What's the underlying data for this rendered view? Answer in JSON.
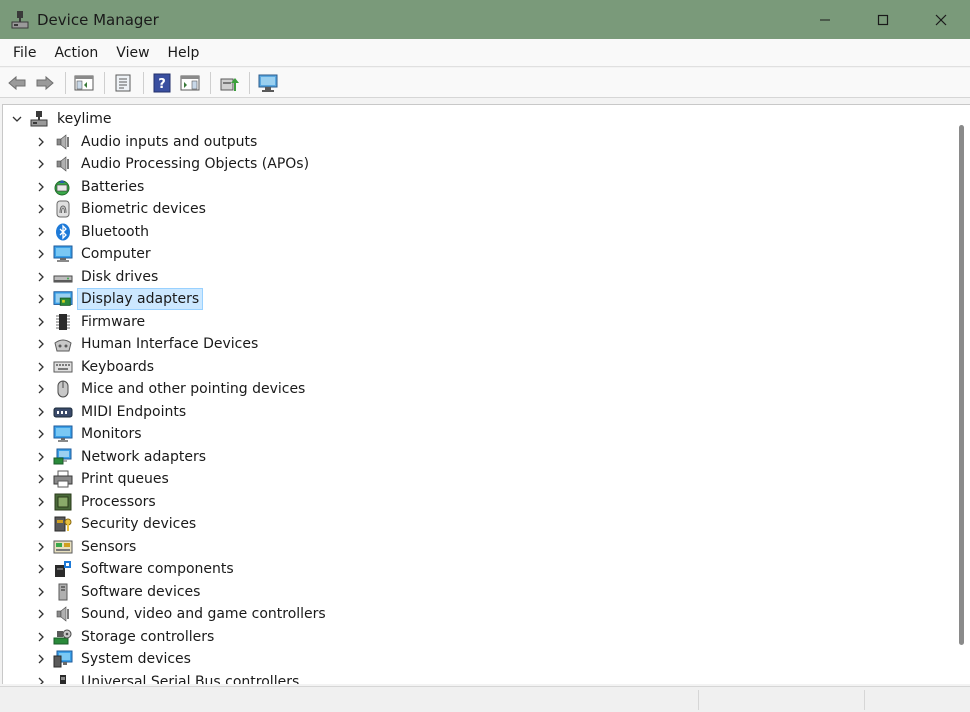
{
  "window": {
    "title": "Device Manager",
    "titlebar_color": "#7a9a7a"
  },
  "menu": [
    "File",
    "Action",
    "View",
    "Help"
  ],
  "toolbar": {
    "buttons": [
      "back-icon",
      "forward-icon",
      "show-hide-console-tree-icon",
      "properties-icon",
      "help-icon",
      "show-action-pane-icon",
      "update-driver-icon",
      "scan-hardware-changes-icon"
    ]
  },
  "tree": {
    "root_label": "keylime",
    "selected_label": "Display adapters",
    "categories": [
      {
        "label": "Audio inputs and outputs",
        "icon": "speaker-icon"
      },
      {
        "label": "Audio Processing Objects (APOs)",
        "icon": "speaker-icon"
      },
      {
        "label": "Batteries",
        "icon": "battery-icon"
      },
      {
        "label": "Biometric devices",
        "icon": "fingerprint-icon"
      },
      {
        "label": "Bluetooth",
        "icon": "bluetooth-icon"
      },
      {
        "label": "Computer",
        "icon": "computer-icon"
      },
      {
        "label": "Disk drives",
        "icon": "disk-drive-icon"
      },
      {
        "label": "Display adapters",
        "icon": "display-adapter-icon"
      },
      {
        "label": "Firmware",
        "icon": "firmware-chip-icon"
      },
      {
        "label": "Human Interface Devices",
        "icon": "hid-icon"
      },
      {
        "label": "Keyboards",
        "icon": "keyboard-icon"
      },
      {
        "label": "Mice and other pointing devices",
        "icon": "mouse-icon"
      },
      {
        "label": "MIDI Endpoints",
        "icon": "midi-icon"
      },
      {
        "label": "Monitors",
        "icon": "monitor-icon"
      },
      {
        "label": "Network adapters",
        "icon": "network-adapter-icon"
      },
      {
        "label": "Print queues",
        "icon": "printer-icon"
      },
      {
        "label": "Processors",
        "icon": "processor-icon"
      },
      {
        "label": "Security devices",
        "icon": "security-device-icon"
      },
      {
        "label": "Sensors",
        "icon": "sensor-icon"
      },
      {
        "label": "Software components",
        "icon": "software-component-icon"
      },
      {
        "label": "Software devices",
        "icon": "software-device-icon"
      },
      {
        "label": "Sound, video and game controllers",
        "icon": "speaker-icon"
      },
      {
        "label": "Storage controllers",
        "icon": "storage-controller-icon"
      },
      {
        "label": "System devices",
        "icon": "system-device-icon"
      },
      {
        "label": "Universal Serial Bus controllers",
        "icon": "usb-icon"
      }
    ]
  },
  "colors": {
    "selection_bg": "#cce8ff",
    "selection_border": "#99d1ff"
  }
}
